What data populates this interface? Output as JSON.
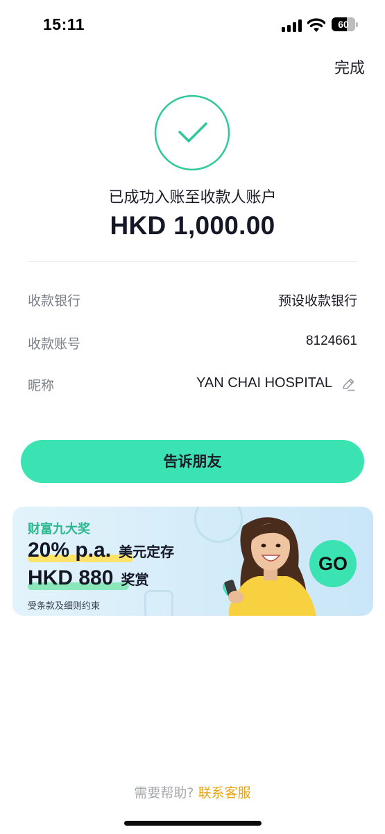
{
  "status_bar": {
    "time": "15:11",
    "battery": "60",
    "icons": [
      "signal-icon",
      "wifi-icon",
      "battery-icon"
    ]
  },
  "header": {
    "done_label": "完成"
  },
  "result": {
    "icon": "check-circle-icon",
    "message": "已成功入账至收款人账户",
    "amount": "HKD 1,000.00"
  },
  "details": [
    {
      "label": "收款银行",
      "value": "预设收款银行"
    },
    {
      "label": "收款账号",
      "value": "8124661"
    },
    {
      "label": "昵称",
      "value": "YAN CHAI HOSPITAL",
      "icon": "edit-pencil-icon"
    }
  ],
  "share_button": {
    "label": "告诉朋友"
  },
  "promo": {
    "title": "财富九大奖",
    "line1_big": "20% p.a.",
    "line1_small": "美元定存",
    "line2_big": "HKD 880",
    "line2_small": "奖赏",
    "terms": "受条款及细则约束",
    "go_label": "GO"
  },
  "footer": {
    "help_text": "需要帮助?",
    "contact_label": "联系客服"
  },
  "colors": {
    "accent": "#3be3b3",
    "success_green": "#2ec99a",
    "link_orange": "#e8a515",
    "label_gray": "#7a7f87",
    "promo_yellow": "#fde36a"
  }
}
